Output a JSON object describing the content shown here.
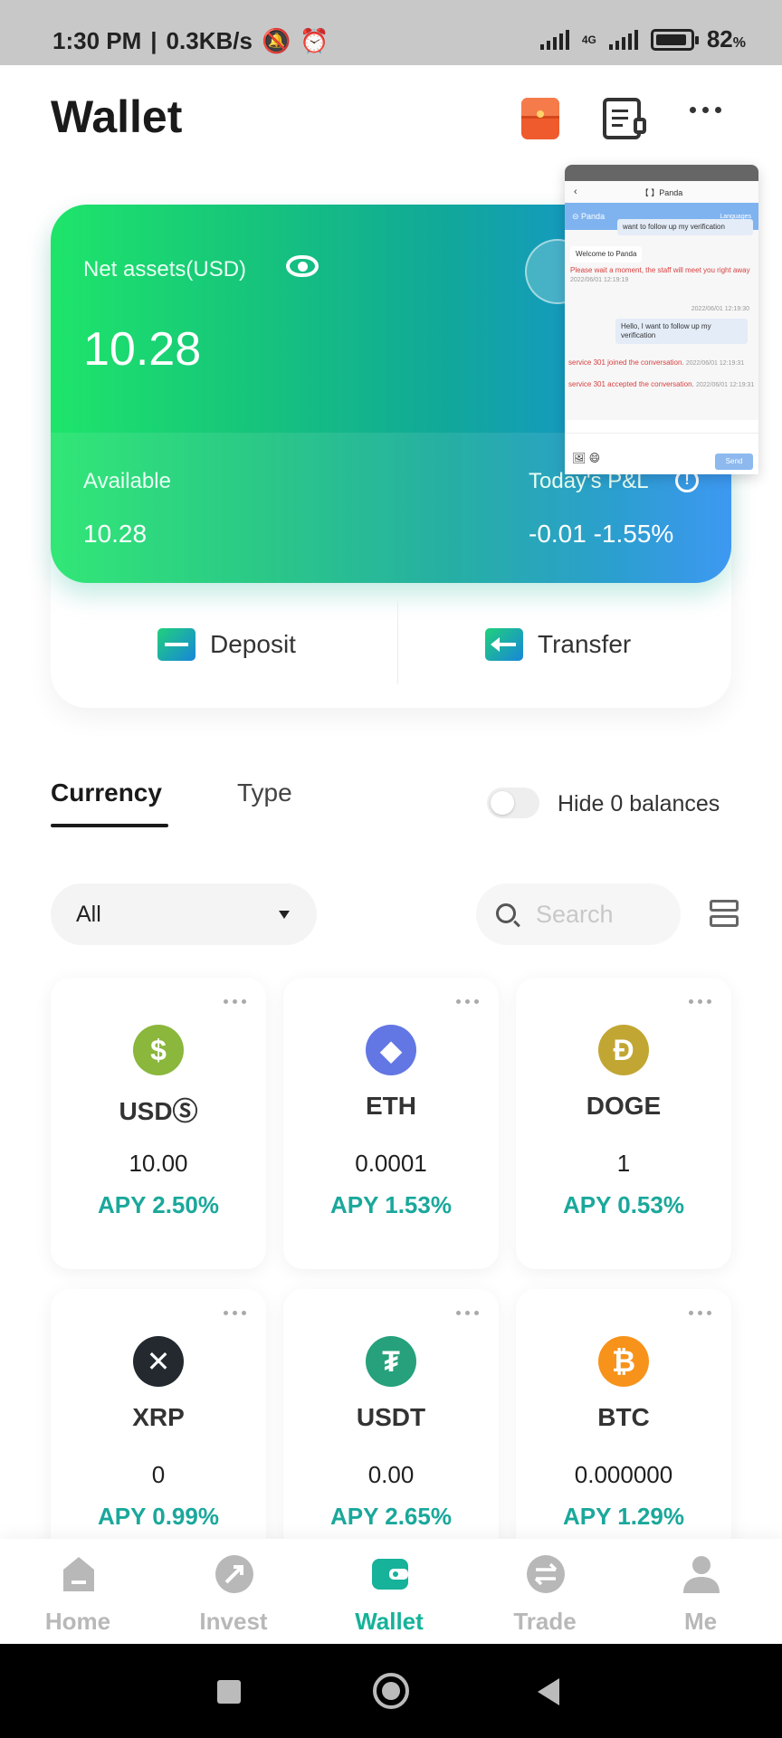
{
  "status_bar": {
    "time": "1:30 PM",
    "speed": "0.3KB/s",
    "network": "4G",
    "battery": "82"
  },
  "header": {
    "title": "Wallet"
  },
  "assets": {
    "net_label": "Net assets(USD)",
    "net_value": "10.28",
    "available_label": "Available",
    "available_value": "10.28",
    "pnl_label": "Today's P&L",
    "pnl_value": "-0.01  -1.55%"
  },
  "actions": {
    "deposit": "Deposit",
    "transfer": "Transfer"
  },
  "tabs": {
    "currency": "Currency",
    "type": "Type"
  },
  "hide_zero": {
    "label": "Hide 0 balances",
    "enabled": false
  },
  "filter": {
    "selected": "All"
  },
  "search": {
    "placeholder": "Search"
  },
  "coins": [
    {
      "symbol": "USDⓈ",
      "balance": "10.00",
      "apy": "APY 2.50%",
      "icon": "dollar-coin-icon",
      "color": "#8ab73c",
      "glyph": "$"
    },
    {
      "symbol": "ETH",
      "balance": "0.0001",
      "apy": "APY 1.53%",
      "icon": "ethereum-icon",
      "color": "#6277e3",
      "glyph": "◆"
    },
    {
      "symbol": "DOGE",
      "balance": "1",
      "apy": "APY 0.53%",
      "icon": "dogecoin-icon",
      "color": "#c2a633",
      "glyph": "Ð"
    },
    {
      "symbol": "XRP",
      "balance": "0",
      "apy": "APY 0.99%",
      "icon": "xrp-icon",
      "color": "#23292f",
      "glyph": "✕"
    },
    {
      "symbol": "USDT",
      "balance": "0.00",
      "apy": "APY 2.65%",
      "icon": "tether-icon",
      "color": "#26a17b",
      "glyph": "₮"
    },
    {
      "symbol": "BTC",
      "balance": "0.000000",
      "apy": "APY 1.29%",
      "icon": "bitcoin-icon",
      "color": "#f7931a",
      "glyph": "₿"
    }
  ],
  "bottom_nav": [
    {
      "label": "Home",
      "active": false
    },
    {
      "label": "Invest",
      "active": false
    },
    {
      "label": "Wallet",
      "active": true
    },
    {
      "label": "Trade",
      "active": false
    },
    {
      "label": "Me",
      "active": false
    }
  ],
  "chat_overlay": {
    "nav_title": "【      】Panda",
    "header_name": "Panda",
    "header_link": "Languages",
    "msg_top": "want to follow up my verification",
    "msg_welcome": "Welcome to Panda",
    "msg_wait": "Please wait a moment, the staff will meet you right away",
    "ts_wait": "2022/06/01 12:19:19",
    "ts_user": "2022/06/01 12:19:30",
    "msg_user": "Hello, I want to follow up my verification",
    "sys_joined": "service 301 joined the conversation.",
    "ts_joined": "2022/06/01 12:19:31",
    "sys_accepted": "service 301 accepted the conversation.",
    "ts_accepted": "2022/06/01 12:19:31",
    "send": "Send"
  }
}
